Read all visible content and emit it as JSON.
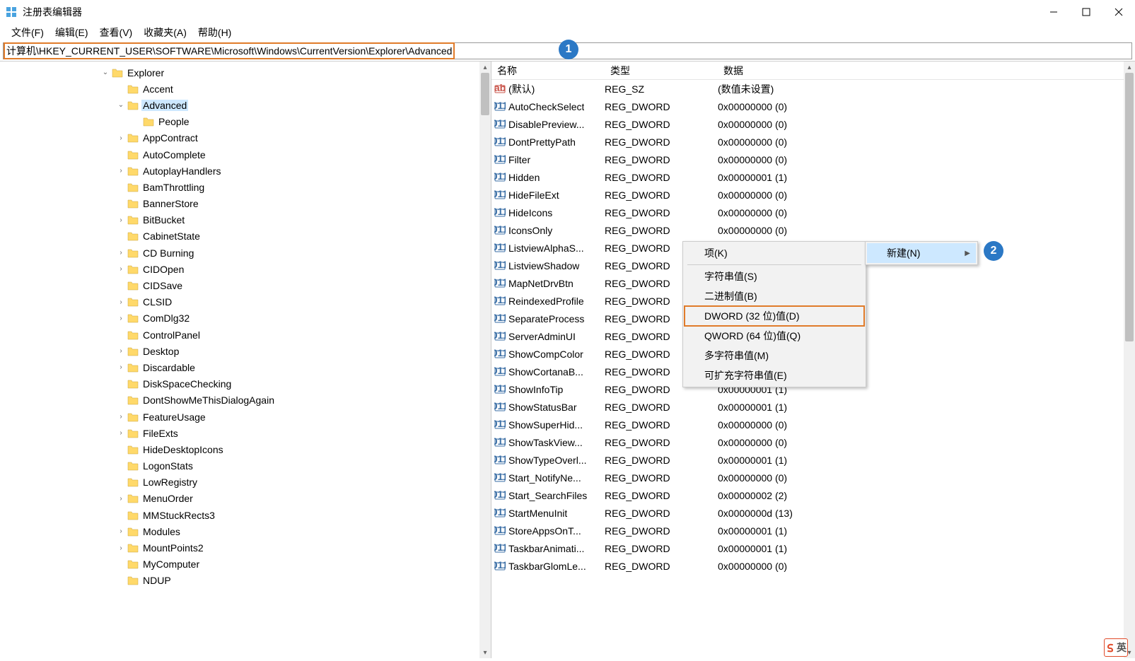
{
  "window": {
    "title": "注册表编辑器"
  },
  "menu": {
    "file": "文件(F)",
    "edit": "编辑(E)",
    "view": "查看(V)",
    "favorites": "收藏夹(A)",
    "help": "帮助(H)"
  },
  "address": {
    "path": "计算机\\HKEY_CURRENT_USER\\SOFTWARE\\Microsoft\\Windows\\CurrentVersion\\Explorer\\Advanced"
  },
  "callouts": {
    "one": "1",
    "two": "2"
  },
  "tree": {
    "items": [
      {
        "indent": 6,
        "expander": "open",
        "label": "Explorer"
      },
      {
        "indent": 7,
        "expander": "none",
        "label": "Accent"
      },
      {
        "indent": 7,
        "expander": "open",
        "label": "Advanced",
        "selected": true
      },
      {
        "indent": 8,
        "expander": "none",
        "label": "People"
      },
      {
        "indent": 7,
        "expander": "closed",
        "label": "AppContract"
      },
      {
        "indent": 7,
        "expander": "none",
        "label": "AutoComplete"
      },
      {
        "indent": 7,
        "expander": "closed",
        "label": "AutoplayHandlers"
      },
      {
        "indent": 7,
        "expander": "none",
        "label": "BamThrottling"
      },
      {
        "indent": 7,
        "expander": "none",
        "label": "BannerStore"
      },
      {
        "indent": 7,
        "expander": "closed",
        "label": "BitBucket"
      },
      {
        "indent": 7,
        "expander": "none",
        "label": "CabinetState"
      },
      {
        "indent": 7,
        "expander": "closed",
        "label": "CD Burning"
      },
      {
        "indent": 7,
        "expander": "closed",
        "label": "CIDOpen"
      },
      {
        "indent": 7,
        "expander": "none",
        "label": "CIDSave"
      },
      {
        "indent": 7,
        "expander": "closed",
        "label": "CLSID"
      },
      {
        "indent": 7,
        "expander": "closed",
        "label": "ComDlg32"
      },
      {
        "indent": 7,
        "expander": "none",
        "label": "ControlPanel"
      },
      {
        "indent": 7,
        "expander": "closed",
        "label": "Desktop"
      },
      {
        "indent": 7,
        "expander": "closed",
        "label": "Discardable"
      },
      {
        "indent": 7,
        "expander": "none",
        "label": "DiskSpaceChecking"
      },
      {
        "indent": 7,
        "expander": "none",
        "label": "DontShowMeThisDialogAgain"
      },
      {
        "indent": 7,
        "expander": "closed",
        "label": "FeatureUsage"
      },
      {
        "indent": 7,
        "expander": "closed",
        "label": "FileExts"
      },
      {
        "indent": 7,
        "expander": "none",
        "label": "HideDesktopIcons"
      },
      {
        "indent": 7,
        "expander": "none",
        "label": "LogonStats"
      },
      {
        "indent": 7,
        "expander": "none",
        "label": "LowRegistry"
      },
      {
        "indent": 7,
        "expander": "closed",
        "label": "MenuOrder"
      },
      {
        "indent": 7,
        "expander": "none",
        "label": "MMStuckRects3"
      },
      {
        "indent": 7,
        "expander": "closed",
        "label": "Modules"
      },
      {
        "indent": 7,
        "expander": "closed",
        "label": "MountPoints2"
      },
      {
        "indent": 7,
        "expander": "none",
        "label": "MyComputer"
      },
      {
        "indent": 7,
        "expander": "none",
        "label": "NDUP"
      }
    ]
  },
  "columns": {
    "name": "名称",
    "type": "类型",
    "data": "数据"
  },
  "values": [
    {
      "icon": "str",
      "name": "(默认)",
      "type": "REG_SZ",
      "data": "(数值未设置)"
    },
    {
      "icon": "bin",
      "name": "AutoCheckSelect",
      "type": "REG_DWORD",
      "data": "0x00000000 (0)"
    },
    {
      "icon": "bin",
      "name": "DisablePreview...",
      "type": "REG_DWORD",
      "data": "0x00000000 (0)"
    },
    {
      "icon": "bin",
      "name": "DontPrettyPath",
      "type": "REG_DWORD",
      "data": "0x00000000 (0)"
    },
    {
      "icon": "bin",
      "name": "Filter",
      "type": "REG_DWORD",
      "data": "0x00000000 (0)"
    },
    {
      "icon": "bin",
      "name": "Hidden",
      "type": "REG_DWORD",
      "data": "0x00000001 (1)"
    },
    {
      "icon": "bin",
      "name": "HideFileExt",
      "type": "REG_DWORD",
      "data": "0x00000000 (0)"
    },
    {
      "icon": "bin",
      "name": "HideIcons",
      "type": "REG_DWORD",
      "data": "0x00000000 (0)"
    },
    {
      "icon": "bin",
      "name": "IconsOnly",
      "type": "REG_DWORD",
      "data": "0x00000000 (0)"
    },
    {
      "icon": "bin",
      "name": "ListviewAlphaS...",
      "type": "REG_DWORD",
      "data": ""
    },
    {
      "icon": "bin",
      "name": "ListviewShadow",
      "type": "REG_DWORD",
      "data": ""
    },
    {
      "icon": "bin",
      "name": "MapNetDrvBtn",
      "type": "REG_DWORD",
      "data": ""
    },
    {
      "icon": "bin",
      "name": "ReindexedProfile",
      "type": "REG_DWORD",
      "data": ""
    },
    {
      "icon": "bin",
      "name": "SeparateProcess",
      "type": "REG_DWORD",
      "data": ""
    },
    {
      "icon": "bin",
      "name": "ServerAdminUI",
      "type": "REG_DWORD",
      "data": ""
    },
    {
      "icon": "bin",
      "name": "ShowCompColor",
      "type": "REG_DWORD",
      "data": ""
    },
    {
      "icon": "bin",
      "name": "ShowCortanaB...",
      "type": "REG_DWORD",
      "data": ""
    },
    {
      "icon": "bin",
      "name": "ShowInfoTip",
      "type": "REG_DWORD",
      "data": "0x00000001 (1)"
    },
    {
      "icon": "bin",
      "name": "ShowStatusBar",
      "type": "REG_DWORD",
      "data": "0x00000001 (1)"
    },
    {
      "icon": "bin",
      "name": "ShowSuperHid...",
      "type": "REG_DWORD",
      "data": "0x00000000 (0)"
    },
    {
      "icon": "bin",
      "name": "ShowTaskView...",
      "type": "REG_DWORD",
      "data": "0x00000000 (0)"
    },
    {
      "icon": "bin",
      "name": "ShowTypeOverl...",
      "type": "REG_DWORD",
      "data": "0x00000001 (1)"
    },
    {
      "icon": "bin",
      "name": "Start_NotifyNe...",
      "type": "REG_DWORD",
      "data": "0x00000000 (0)"
    },
    {
      "icon": "bin",
      "name": "Start_SearchFiles",
      "type": "REG_DWORD",
      "data": "0x00000002 (2)"
    },
    {
      "icon": "bin",
      "name": "StartMenuInit",
      "type": "REG_DWORD",
      "data": "0x0000000d (13)"
    },
    {
      "icon": "bin",
      "name": "StoreAppsOnT...",
      "type": "REG_DWORD",
      "data": "0x00000001 (1)"
    },
    {
      "icon": "bin",
      "name": "TaskbarAnimati...",
      "type": "REG_DWORD",
      "data": "0x00000001 (1)"
    },
    {
      "icon": "bin",
      "name": "TaskbarGlomLe...",
      "type": "REG_DWORD",
      "data": "0x00000000 (0)"
    }
  ],
  "context_parent": {
    "new": "新建(N)"
  },
  "context_sub": {
    "key": "项(K)",
    "string": "字符串值(S)",
    "binary": "二进制值(B)",
    "dword": "DWORD (32 位)值(D)",
    "qword": "QWORD (64 位)值(Q)",
    "multi": "多字符串值(M)",
    "expand": "可扩充字符串值(E)"
  },
  "ime": {
    "label": "英"
  }
}
